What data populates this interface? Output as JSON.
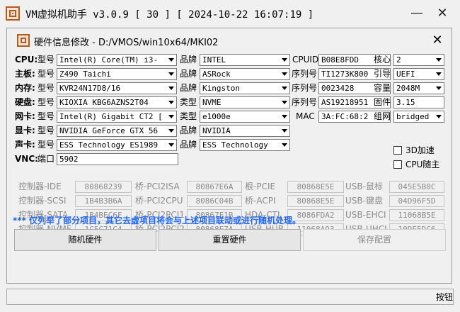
{
  "window": {
    "app": "VM虚拟机助手",
    "version": "v3.0.9",
    "info": "[ 30 ] [ 2024-10-22 16:07:19 ]",
    "minimize": "—",
    "close": "✕"
  },
  "dialog": {
    "title": "硬件信息修改 - D:/VMOS/win10x64/MKI02",
    "close": "✕"
  },
  "hardware": {
    "cpu": {
      "label": "CPU:",
      "sub": "型号",
      "model": "Intel(R) Core(TM) i3-",
      "brand_label": "品牌",
      "brand": "INTEL",
      "id_label": "CPUID",
      "id": "B08E8FDD",
      "extra_label": "核心",
      "extra": "2"
    },
    "board": {
      "label": "主板:",
      "sub": "型号",
      "model": "Z490 Taichi",
      "brand_label": "品牌",
      "brand": "ASRock",
      "id_label": "序列号",
      "id": "TI1273K800",
      "extra_label": "引导",
      "extra": "UEFI"
    },
    "mem": {
      "label": "内存:",
      "sub": "型号",
      "model": "KVR24N17D8/16",
      "brand_label": "品牌",
      "brand": "Kingston",
      "id_label": "序列号",
      "id": "0023428",
      "extra_label": "容量",
      "extra": "2048M"
    },
    "disk": {
      "label": "硬盘:",
      "sub": "型号",
      "model": "KIOXIA KBG6AZNS2T04",
      "brand_label": "类型",
      "brand": "NVME",
      "id_label": "序列号",
      "id": "AS19218951",
      "extra_label": "固件",
      "extra": "3.15"
    },
    "nic": {
      "label": "网卡:",
      "sub": "型号",
      "model": "Intel(R) Gigabit CT2 [",
      "brand_label": "类型",
      "brand": "e1000e",
      "id_label": "MAC",
      "id": "3A:FC:68:2",
      "extra_label": "组网",
      "extra": "bridged"
    },
    "gpu": {
      "label": "显卡:",
      "sub": "型号",
      "model": "NVIDIA GeForce GTX 56",
      "brand_label": "品牌",
      "brand": "NVIDIA"
    },
    "audio": {
      "label": "声卡:",
      "sub": "型号",
      "model": "ESS Technology ES1989",
      "brand_label": "品牌",
      "brand": "ESS Technology"
    },
    "vnc": {
      "label": "VNC:",
      "sub": "端口",
      "port": "5902"
    }
  },
  "options": {
    "accel3d": "3D加速",
    "cpu_follow": "CPU随主"
  },
  "controllers": [
    [
      {
        "label": "控制器-IDE",
        "value": "80868239"
      },
      {
        "label": "桥-PCI2ISA",
        "value": "80867E6A"
      },
      {
        "label": "根-PCIE",
        "value": "80868E5E"
      },
      {
        "label": "USB-鼠标",
        "value": "045E5B0C"
      }
    ],
    [
      {
        "label": "控制器-SCSI",
        "value": "1B4B3B6A"
      },
      {
        "label": "桥-PCI2CPU",
        "value": "8086C04B"
      },
      {
        "label": "桥-ACPI",
        "value": "80868E5E"
      },
      {
        "label": "USB-键盘",
        "value": "04D96F5D"
      }
    ],
    [
      {
        "label": "控制器-SATA",
        "value": "1B4BEC6F"
      },
      {
        "label": "桥-PCI2PCI1",
        "value": "80867F1B"
      },
      {
        "label": "HDA-CTL",
        "value": "8086FDA2"
      },
      {
        "label": "USB-EHCI",
        "value": "11068B5E"
      }
    ],
    [
      {
        "label": "控制器-NVME",
        "value": "1C5C71C4"
      },
      {
        "label": "桥-PCI2PCI2",
        "value": "80868E7A"
      },
      {
        "label": "USB-HUB",
        "value": "11068A93"
      },
      {
        "label": "USB-UHCI",
        "value": "10DE5DC6"
      }
    ]
  ],
  "note": "*** 仅列举了部分项目，其它去虚项目将会与上述项目联动或进行随机处理。",
  "buttons": {
    "random": "随机硬件",
    "reset": "重置硬件",
    "save": "保存配置"
  },
  "status": {
    "right": "按钮"
  },
  "colors": {
    "accent": "#b45a1c",
    "note": "#1e66ff",
    "disabled": "#8c8c8c"
  }
}
